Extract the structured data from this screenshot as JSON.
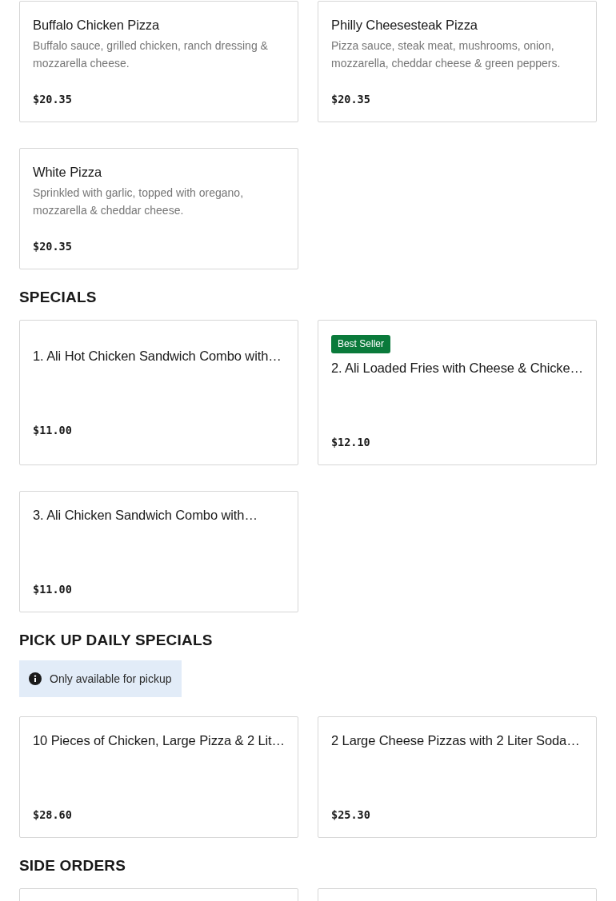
{
  "sections": [
    {
      "items": [
        {
          "kind": "item",
          "title": "Buffalo Chicken Pizza",
          "description": "Buffalo sauce, grilled chicken, ranch dressing & mozzarella cheese.",
          "price": "$20.35"
        },
        {
          "kind": "item",
          "title": "Philly Cheesesteak Pizza",
          "description": "Pizza sauce, steak meat, mushrooms, onion, mozzarella, cheddar cheese & green peppers.",
          "price": "$20.35"
        },
        {
          "kind": "item",
          "title": "White Pizza",
          "description": "Sprinkled with garlic, topped with oregano, mozzarella & cheddar cheese.",
          "price": "$20.35"
        }
      ]
    },
    {
      "title": "SPECIALS",
      "items": [
        {
          "kind": "item",
          "title": "1. Ali Hot Chicken Sandwich Combo with…",
          "price": "$11.00"
        },
        {
          "kind": "item",
          "badge": "Best Seller",
          "title": "2. Ali Loaded Fries with Cheese & Chicke…",
          "price": "$12.10"
        },
        {
          "kind": "item",
          "title": "3. Ali Chicken Sandwich Combo with…",
          "price": "$11.00"
        }
      ]
    },
    {
      "title": "PICK UP DAILY SPECIALS",
      "notice": "Only available for pickup",
      "items": [
        {
          "kind": "item",
          "title": "10 Pieces of Chicken, Large Pizza & 2 Lit…",
          "price": "$28.60"
        },
        {
          "kind": "item",
          "title": "2 Large Cheese Pizzas with 2 Liter Soda…",
          "price": "$25.30"
        }
      ]
    },
    {
      "title": "SIDE ORDERS",
      "items": [
        {
          "kind": "cut_off"
        },
        {
          "kind": "cut_off"
        }
      ]
    }
  ]
}
